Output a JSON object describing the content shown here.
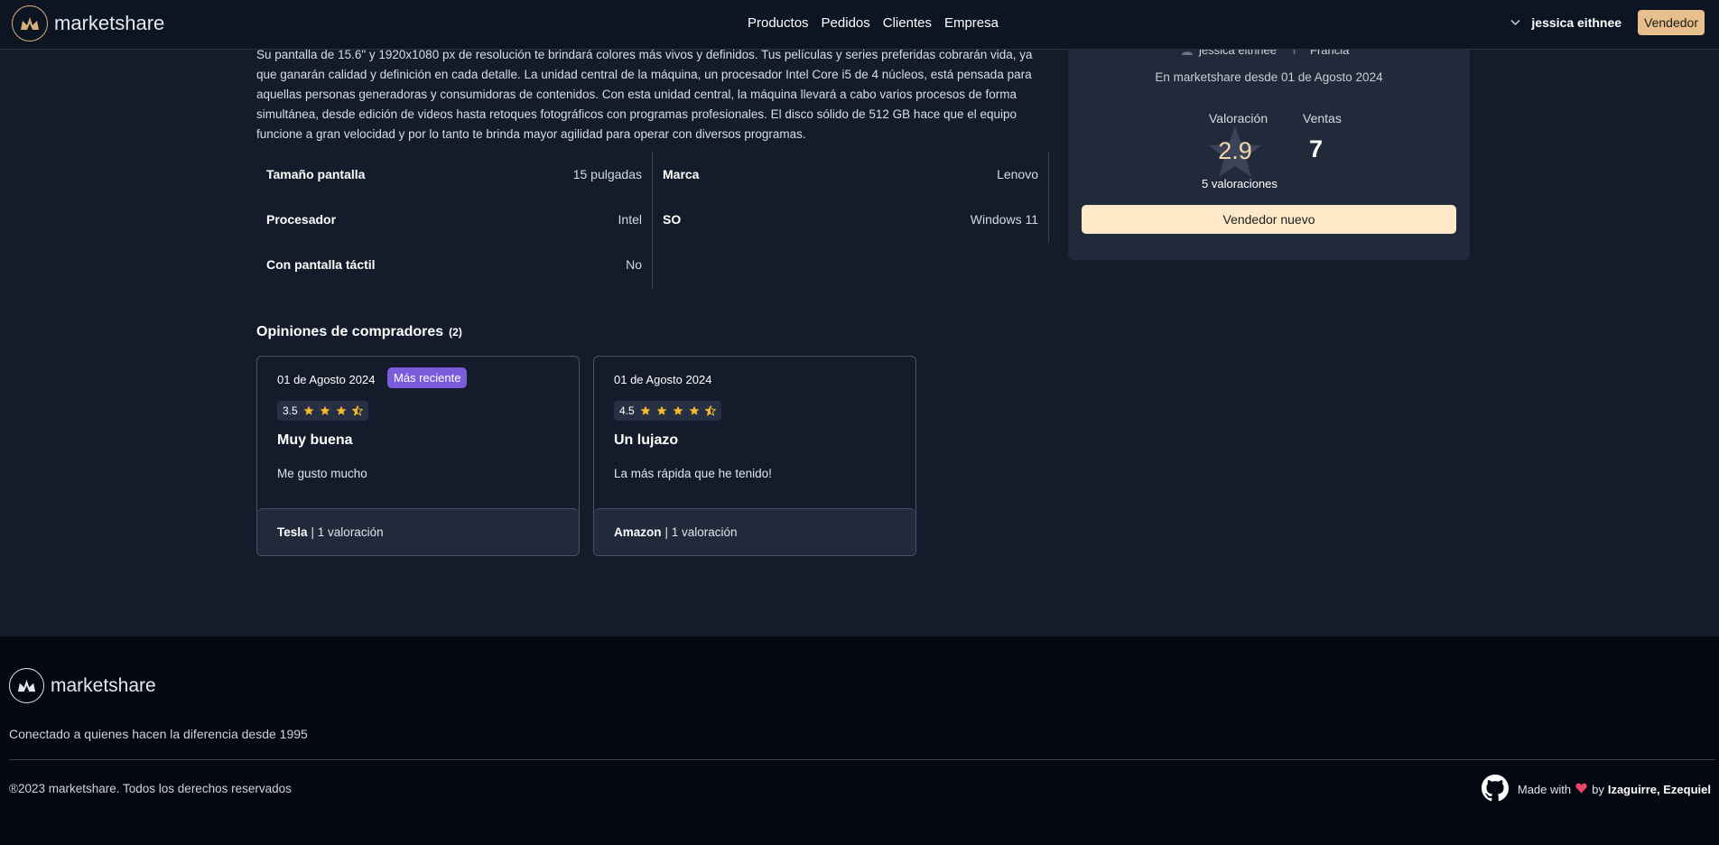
{
  "header": {
    "brand": "marketshare",
    "nav": [
      "Productos",
      "Pedidos",
      "Clientes",
      "Empresa"
    ],
    "user_name": "jessica eithnee",
    "seller_button": "Vendedor"
  },
  "product": {
    "description": "Su pantalla de 15.6\" y 1920x1080 px de resolución te brindará colores más vivos y definidos. Tus películas y series preferidas cobrarán vida, ya que ganarán calidad y definición en cada detalle.  La unidad central de la máquina, un procesador Intel Core i5 de 4 núcleos, está pensada para aquellas personas generadoras y consumidoras de contenidos. Con esta unidad central, la máquina llevará a cabo varios procesos de forma simultánea, desde edición de videos hasta retoques fotográficos con programas profesionales.  El disco sólido de 512 GB hace que el equipo funcione a gran velocidad y por lo tanto te brinda mayor agilidad para operar con diversos programas.",
    "specs_left": [
      {
        "key": "Tamaño pantalla",
        "value": "15 pulgadas"
      },
      {
        "key": "Procesador",
        "value": "Intel"
      },
      {
        "key": "Con pantalla táctil",
        "value": "No"
      }
    ],
    "specs_right": [
      {
        "key": "Marca",
        "value": "Lenovo"
      },
      {
        "key": "SO",
        "value": "Windows 11"
      }
    ]
  },
  "seller": {
    "name": "jessica eithnee",
    "country": "Francia",
    "since": "En marketshare desde 01 de Agosto 2024",
    "rating_label": "Valoración",
    "rating_value": "2.9",
    "sales_label": "Ventas",
    "sales_value": "7",
    "rating_count": "5 valoraciones",
    "badge": "Vendedor nuevo"
  },
  "reviews": {
    "title": "Opiniones de compradores",
    "count": "(2)",
    "items": [
      {
        "date": "01 de Agosto 2024",
        "badge": "Más reciente",
        "score": "3.5",
        "rating": 3.5,
        "title": "Muy buena",
        "body": "Me gusto mucho",
        "author": "Tesla",
        "author_meta": "| 1 valoración"
      },
      {
        "date": "01 de Agosto 2024",
        "badge": "",
        "score": "4.5",
        "rating": 4.5,
        "title": "Un lujazo",
        "body": "La más rápida que he tenido!",
        "author": "Amazon",
        "author_meta": "| 1 valoración"
      }
    ]
  },
  "footer": {
    "brand": "marketshare",
    "tagline": "Conectado a quienes hacen la diferencia desde 1995",
    "copyright": "®2023 marketshare. Todos los derechos reservados",
    "made_with": "Made with",
    "by": "by",
    "authors": "Izaguirre, Ezequiel"
  },
  "colors": {
    "accent": "#e6bf8c",
    "badge": "#7b5cdc",
    "star": "#f5b82e",
    "background": "#141c2b"
  }
}
